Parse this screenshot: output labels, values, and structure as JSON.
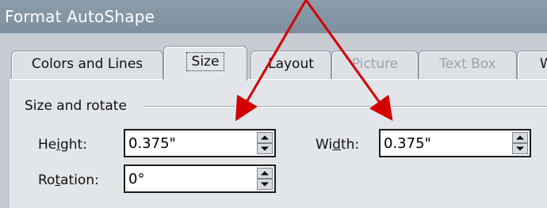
{
  "dialog": {
    "title": "Format AutoShape"
  },
  "tabs": [
    {
      "label": "Colors and Lines",
      "enabled": true,
      "selected": false
    },
    {
      "label": "Size",
      "enabled": true,
      "selected": true
    },
    {
      "label": "Layout",
      "enabled": true,
      "selected": false
    },
    {
      "label": "Picture",
      "enabled": false,
      "selected": false
    },
    {
      "label": "Text Box",
      "enabled": false,
      "selected": false
    },
    {
      "label": "W",
      "enabled": true,
      "selected": false
    }
  ],
  "size_rotate": {
    "section_label": "Size and rotate",
    "height": {
      "label_pre": "He",
      "label_access": "i",
      "label_post": "ght:",
      "value": "0.375\""
    },
    "width": {
      "label_pre": "Wi",
      "label_access": "d",
      "label_post": "th:",
      "value": "0.375\""
    },
    "rotation": {
      "label_pre": "Ro",
      "label_access": "t",
      "label_post": "ation:",
      "value": "0°"
    }
  },
  "annotation": {
    "arrow_color": "#d40000"
  },
  "colors": {
    "titlebar": "#8c9dab",
    "panel": "#e3e6e9"
  }
}
